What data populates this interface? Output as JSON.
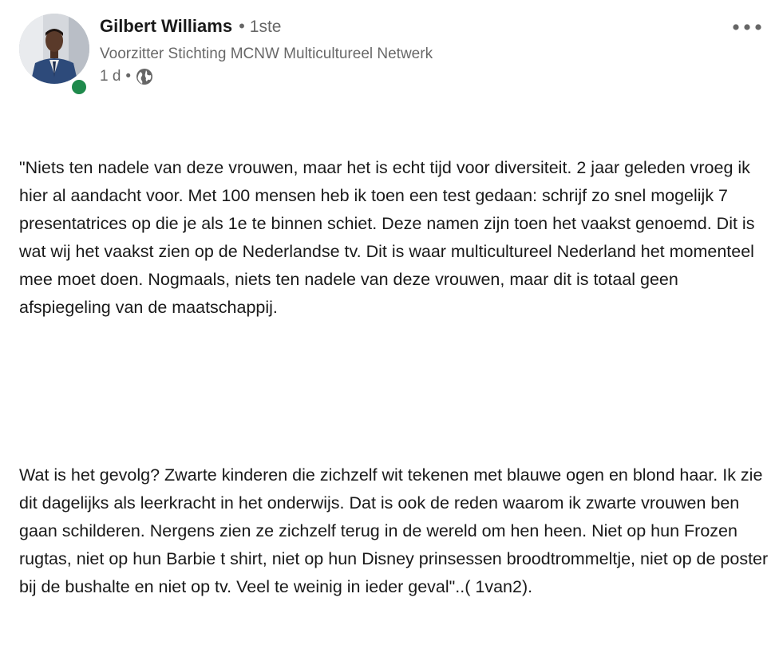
{
  "post": {
    "author": {
      "name": "Gilbert Williams",
      "degree": "1ste",
      "headline": "Voorzitter Stichting MCNW Multicultureel Netwerk",
      "time": "1 d",
      "visibility_icon": "globe-icon",
      "avatar_icon": "profile-photo"
    },
    "menu_icon": "more-horizontal-icon",
    "body": {
      "paragraph_1": "\"Niets ten nadele van deze vrouwen, maar het is echt tijd voor diversiteit. 2 jaar geleden vroeg ik hier al aandacht voor. Met 100 mensen heb ik toen een test gedaan: schrijf zo snel mogelijk 7 presentatrices op die je als 1e te binnen schiet. Deze namen zijn toen het vaakst genoemd. Dit is wat wij het vaakst zien op de Nederlandse tv. Dit is waar multicultureel Nederland het momenteel mee moet doen. Nogmaals, niets ten nadele van deze vrouwen, maar dit is totaal geen afspiegeling van de maatschappij.",
      "paragraph_2": "Wat is het gevolg? Zwarte kinderen die zichzelf wit tekenen met blauwe ogen en blond haar. Ik zie dit dagelijks als leerkracht in het onderwijs. Dat is ook de reden waarom ik zwarte vrouwen ben gaan schilderen. Nergens zien ze zichzelf terug in de wereld om hen heen. Niet op hun Frozen rugtas, niet op hun Barbie t shirt, niet op hun Disney prinsessen broodtrommeltje, niet op de poster bij de bushalte en niet op tv. Veel te weinig in ieder geval\"..( 1van2)."
    },
    "colors": {
      "presence": "#1f8a4c",
      "text_primary": "#1a1a1a",
      "text_secondary": "#666666"
    }
  }
}
